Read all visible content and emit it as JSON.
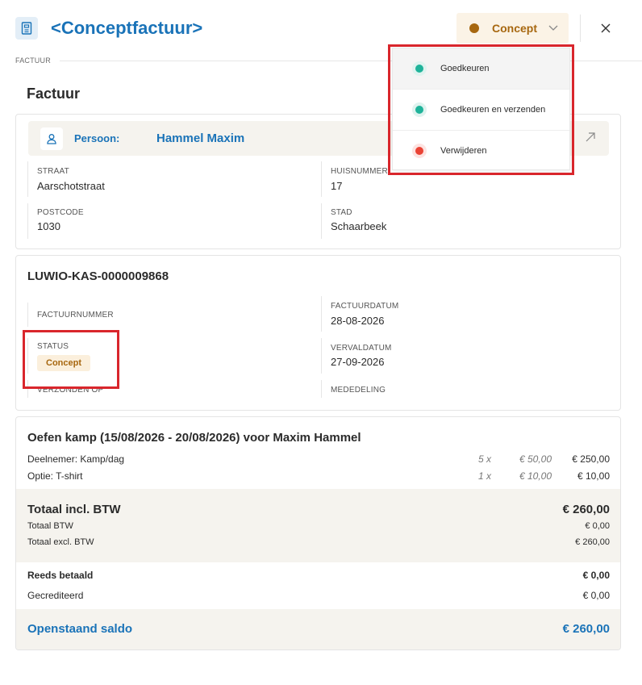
{
  "header": {
    "title": "<Conceptfactuur>",
    "status_label": "Concept",
    "status_color": "#a7670f"
  },
  "tab": {
    "label": "FACTUUR"
  },
  "section_title": "Factuur",
  "person": {
    "label": "Persoon:",
    "name": "Hammel Maxim",
    "fields": {
      "straat_label": "STRAAT",
      "straat_value": "Aarschotstraat",
      "huisnummer_label": "HUISNUMMER",
      "huisnummer_value": "17",
      "postcode_label": "POSTCODE",
      "postcode_value": "1030",
      "stad_label": "STAD",
      "stad_value": "Schaarbeek"
    }
  },
  "invoice": {
    "code": "LUWIO-KAS-0000009868",
    "factuurnummer_label": "FACTUURNUMMER",
    "factuurdatum_label": "FACTUURDATUM",
    "factuurdatum_value": "28-08-2026",
    "status_label": "STATUS",
    "status_value": "Concept",
    "vervaldatum_label": "VERVALDATUM",
    "vervaldatum_value": "27-09-2026",
    "verzonden_label": "VERZONDEN OP",
    "mededeling_label": "MEDEDELING"
  },
  "lines": {
    "title": "Oefen kamp (15/08/2026 - 20/08/2026) voor Maxim Hammel",
    "items": [
      {
        "desc": "Deelnemer: Kamp/dag",
        "qty": "5 x",
        "price": "€ 50,00",
        "amount": "€ 250,00"
      },
      {
        "desc": "Optie: T-shirt",
        "qty": "1 x",
        "price": "€ 10,00",
        "amount": "€ 10,00"
      }
    ]
  },
  "totals": {
    "incl_label": "Totaal incl. BTW",
    "incl_value": "€ 260,00",
    "btw_label": "Totaal BTW",
    "btw_value": "€ 0,00",
    "excl_label": "Totaal excl. BTW",
    "excl_value": "€ 260,00",
    "paid_label": "Reeds betaald",
    "paid_value": "€ 0,00",
    "credited_label": "Gecrediteerd",
    "credited_value": "€ 0,00",
    "saldo_label": "Openstaand saldo",
    "saldo_value": "€ 260,00"
  },
  "dropdown": {
    "items": [
      {
        "label": "Goedkeuren",
        "color": "#1fb39a",
        "ring": "#dff3ef"
      },
      {
        "label": "Goedkeuren en verzenden",
        "color": "#1fb39a",
        "ring": "#dff3ef"
      },
      {
        "label": "Verwijderen",
        "color": "#ea4335",
        "ring": "#fde3e1"
      }
    ]
  },
  "colors": {
    "accent": "#1a73b8",
    "concept": "#a7670f",
    "highlight": "#d9262c"
  }
}
